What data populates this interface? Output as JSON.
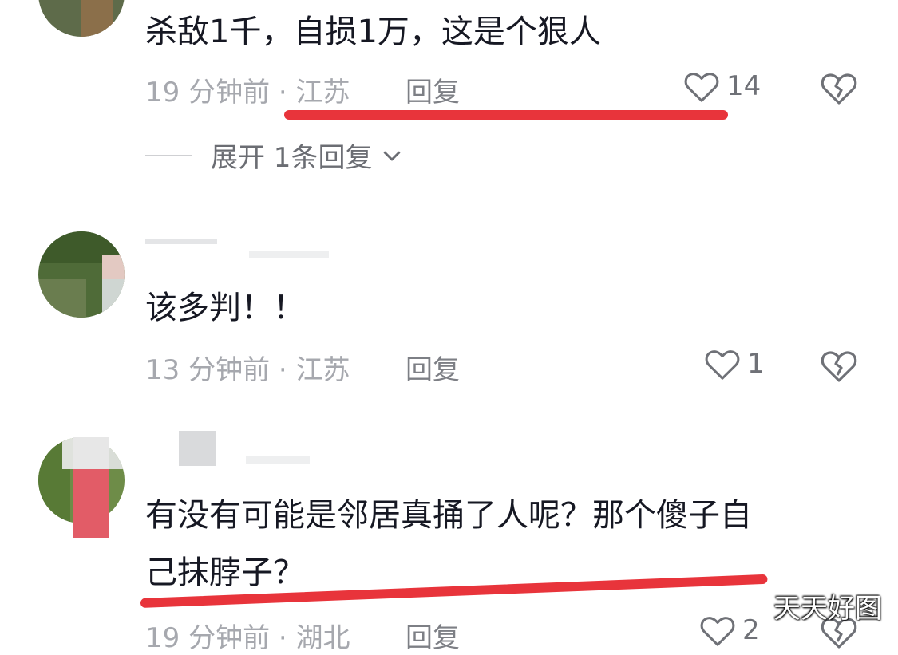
{
  "comments": [
    {
      "text": "杀敌1千，自损1万，这是个狠人",
      "time_location": "19 分钟前 · 江苏",
      "reply_label": "回复",
      "like_count": "14",
      "expand_label": "展开 1条回复"
    },
    {
      "text": "该多判！！",
      "time_location": "13 分钟前 · 江苏",
      "reply_label": "回复",
      "like_count": "1"
    },
    {
      "text_line1": "有没有可能是邻居真捅了人呢？那个傻子自",
      "text_line2": "己抹脖子？",
      "time_location": "19 分钟前 · 湖北",
      "reply_label": "回复",
      "like_count": "2"
    }
  ],
  "icons": {
    "like": "heart-outline-icon",
    "dislike": "broken-heart-icon",
    "expand": "chevron-down-icon"
  },
  "colors": {
    "annotation_red": "#e8343b",
    "meta_gray": "#a6a8ae",
    "text_dark": "#161823"
  },
  "watermark": "天天好图"
}
